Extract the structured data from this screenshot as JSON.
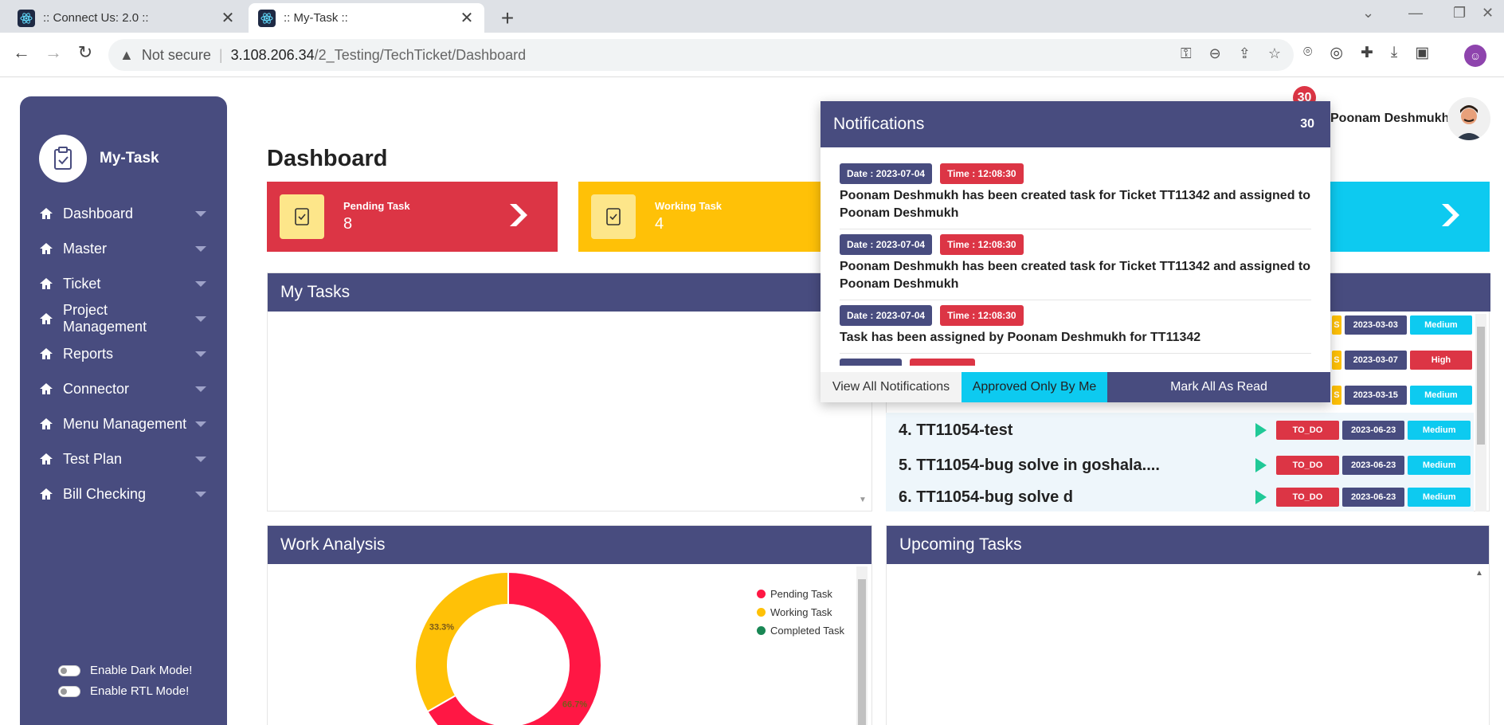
{
  "browser": {
    "tabs": [
      {
        "title": ":: Connect Us: 2.0 ::",
        "active": false
      },
      {
        "title": ":: My-Task ::",
        "active": true
      }
    ],
    "security": "Not secure",
    "url_host": "3.108.206.34",
    "url_path": "/2_Testing/TechTicket/Dashboard"
  },
  "sidebar": {
    "brand": "My-Task",
    "items": [
      {
        "label": "Dashboard"
      },
      {
        "label": "Master"
      },
      {
        "label": "Ticket"
      },
      {
        "label": "Project Management"
      },
      {
        "label": "Reports"
      },
      {
        "label": "Connector"
      },
      {
        "label": "Menu Management"
      },
      {
        "label": "Test Plan"
      },
      {
        "label": "Bill Checking"
      }
    ],
    "dark_mode_label": "Enable Dark Mode!",
    "rtl_mode_label": "Enable RTL Mode!"
  },
  "header": {
    "notification_count": "30",
    "user_name": "Poonam Deshmukh"
  },
  "page": {
    "title": "Dashboard"
  },
  "stats": [
    {
      "label": "Pending Task",
      "value": "8",
      "color": "#dc3545"
    },
    {
      "label": "Working Task",
      "value": "4",
      "color": "#ffc107"
    }
  ],
  "my_tasks": {
    "title": "My Tasks"
  },
  "task_list": {
    "partial_rows": [
      {
        "date": "2023-03-03",
        "priority": "Medium"
      },
      {
        "date": "2023-03-07",
        "priority": "High"
      },
      {
        "date": "2023-03-15",
        "priority": "Medium"
      }
    ],
    "rows": [
      {
        "name": "4. TT11054-test",
        "status": "TO_DO",
        "date": "2023-06-23",
        "priority": "Medium"
      },
      {
        "name": "5. TT11054-bug solve in goshala....",
        "status": "TO_DO",
        "date": "2023-06-23",
        "priority": "Medium"
      },
      {
        "name": "6. TT11054-bug solve d",
        "status": "TO_DO",
        "date": "2023-06-23",
        "priority": "Medium"
      }
    ],
    "partial_status_fragment": "S"
  },
  "work_analysis": {
    "title": "Work Analysis"
  },
  "upcoming": {
    "title": "Upcoming Tasks"
  },
  "chart_data": {
    "type": "pie",
    "categories": [
      "Pending Task",
      "Working Task",
      "Completed Task"
    ],
    "values": [
      66.7,
      33.3,
      0
    ],
    "labels": [
      "66.7%",
      "33.3%",
      ""
    ],
    "colors": [
      "#ff1744",
      "#ffc107",
      "#198754"
    ],
    "legend_position": "top-right"
  },
  "notifications": {
    "title": "Notifications",
    "count": "30",
    "items": [
      {
        "date": "Date : 2023-07-04",
        "time": "Time : 12:08:30",
        "text": "Poonam Deshmukh has been created task for Ticket TT11342 and assigned to Poonam Deshmukh"
      },
      {
        "date": "Date : 2023-07-04",
        "time": "Time : 12:08:30",
        "text": "Poonam Deshmukh has been created task for Ticket TT11342 and assigned to Poonam Deshmukh"
      },
      {
        "date": "Date : 2023-07-04",
        "time": "Time : 12:08:30",
        "text": "Task has been assigned by Poonam Deshmukh for TT11342"
      }
    ],
    "view_all": "View All Notifications",
    "approved_only": "Approved Only By Me",
    "mark_all": "Mark All As Read"
  }
}
